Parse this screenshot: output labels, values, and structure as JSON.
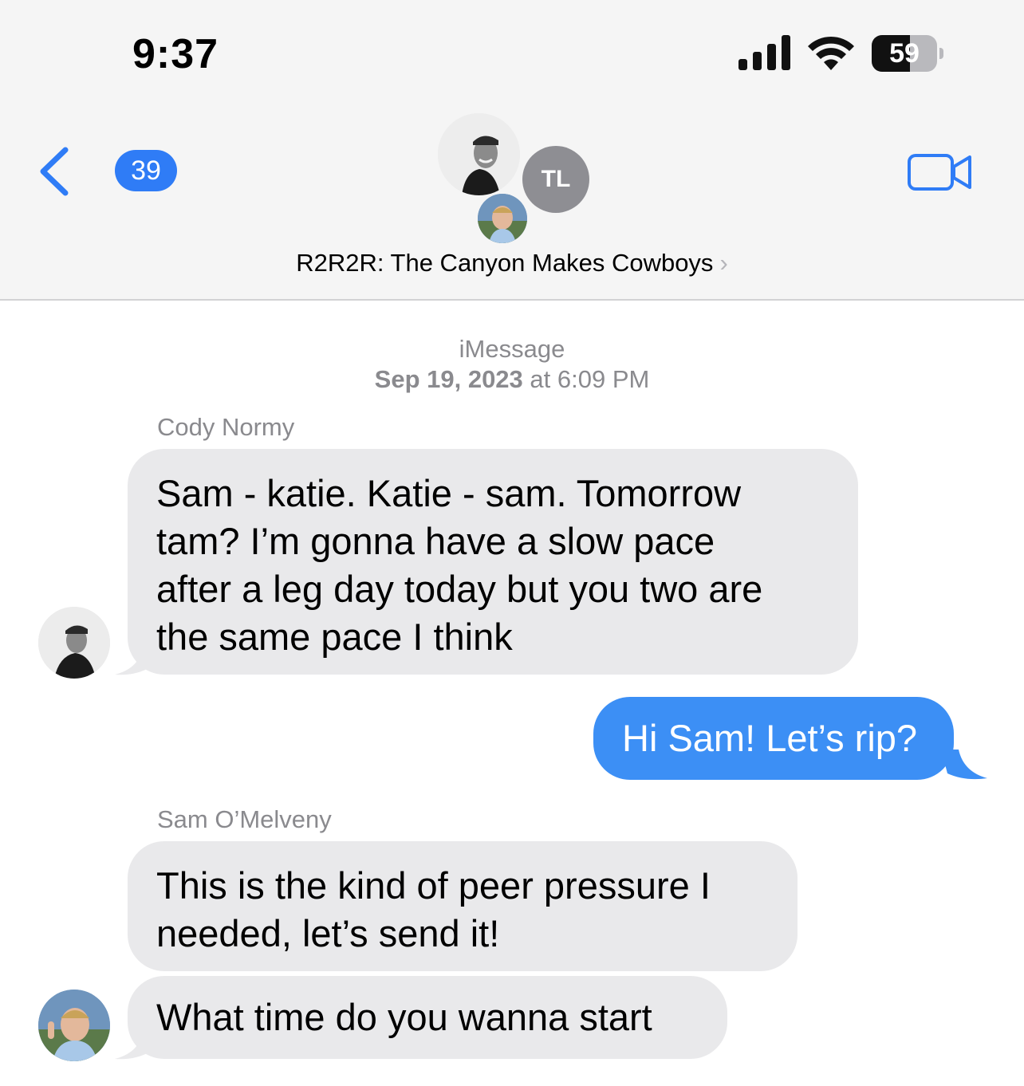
{
  "status_bar": {
    "time": "9:37",
    "battery_level": "59",
    "battery_fraction": 0.59
  },
  "nav": {
    "back_count": "39",
    "group_title": "R2R2R: The Canyon Makes Cowboys",
    "title_chevron": "›",
    "tl_initials": "TL",
    "icons": [
      "back-chevron-icon",
      "video-camera-icon",
      "signal-icon",
      "wifi-icon",
      "battery-icon"
    ]
  },
  "conversation": {
    "service": "iMessage",
    "timestamp_date": "Sep 19, 2023",
    "timestamp_time": "at 6:09 PM"
  },
  "messages": [
    {
      "sender": "Cody Normy",
      "direction": "incoming",
      "lines": [
        "Sam - katie.  Katie - sam.  Tomorrow",
        "tam?   I’m gonna have a slow pace",
        "after a leg day today but you two are",
        "the same pace I think"
      ]
    },
    {
      "sender": "",
      "direction": "outgoing",
      "text": "Hi Sam! Let’s rip?"
    },
    {
      "sender": "Sam O’Melveny",
      "direction": "incoming",
      "lines": [
        "This is the kind of peer pressure I",
        "needed, let’s send it!"
      ]
    },
    {
      "sender": "",
      "direction": "incoming",
      "text": "What time do you wanna start"
    }
  ],
  "colors": {
    "header_bg": "#f5f5f5",
    "incoming_bubble": "#e9e9eb",
    "outgoing_bubble": "#3c8ff5",
    "accent_blue": "#2f7cf6",
    "secondary_text": "#8a8a8e"
  }
}
